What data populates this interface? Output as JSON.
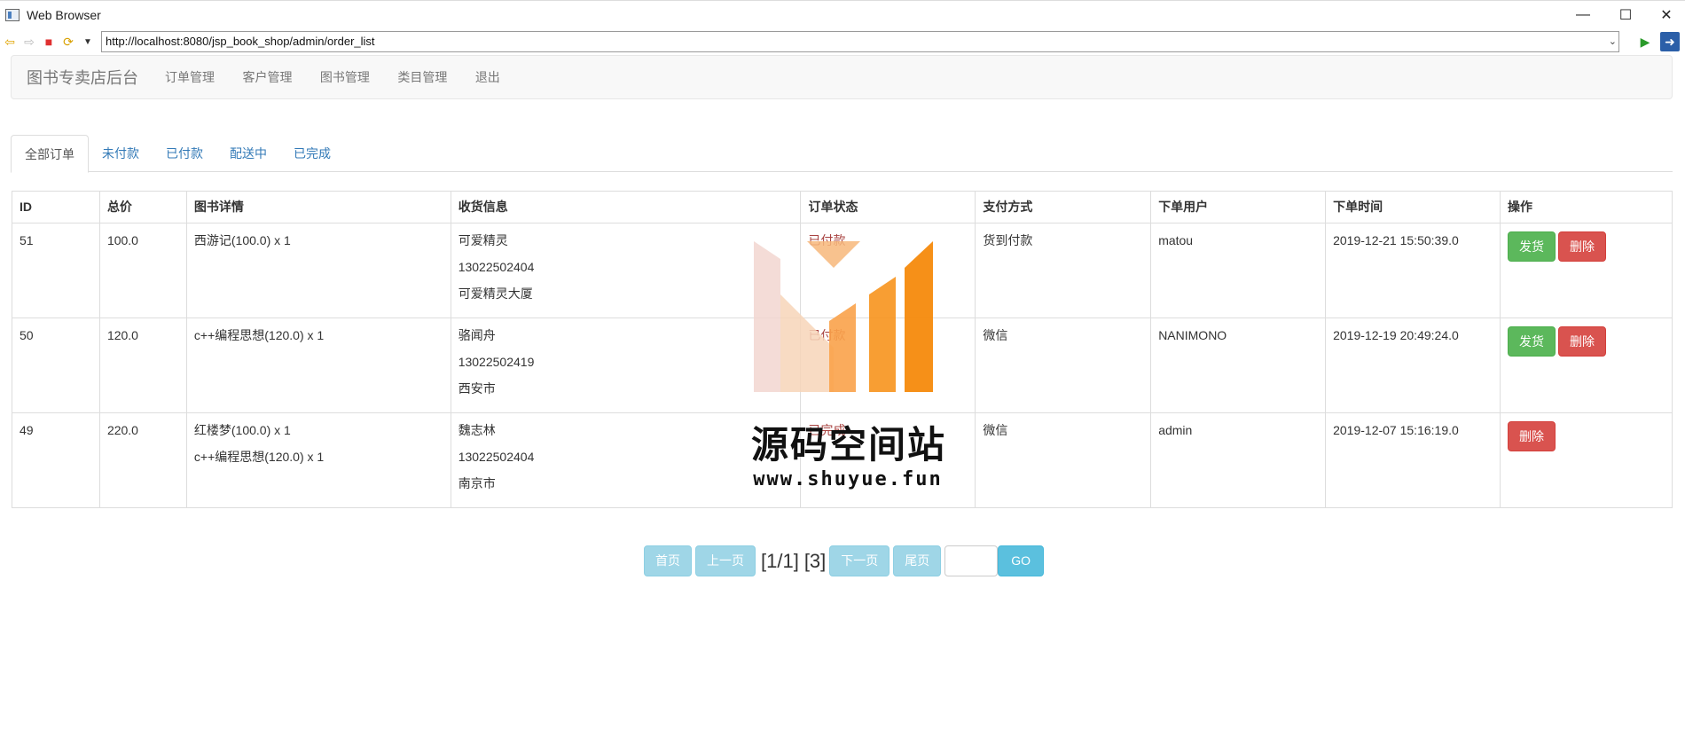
{
  "window": {
    "title": "Web Browser"
  },
  "browser": {
    "url": "http://localhost:8080/jsp_book_shop/admin/order_list"
  },
  "admin": {
    "brand": "图书专卖店后台",
    "menu": [
      "订单管理",
      "客户管理",
      "图书管理",
      "类目管理",
      "退出"
    ]
  },
  "tabs": [
    "全部订单",
    "未付款",
    "已付款",
    "配送中",
    "已完成"
  ],
  "table": {
    "headers": [
      "ID",
      "总价",
      "图书详情",
      "收货信息",
      "订单状态",
      "支付方式",
      "下单用户",
      "下单时间",
      "操作"
    ],
    "rows": [
      {
        "id": "51",
        "total": "100.0",
        "books": [
          "西游记(100.0) x 1"
        ],
        "recipient": "可爱精灵",
        "phone": "13022502404",
        "address": "可爱精灵大厦",
        "status": "已付款",
        "payment": "货到付款",
        "user": "matou",
        "time": "2019-12-21 15:50:39.0",
        "ship_label": "发货",
        "delete_label": "删除"
      },
      {
        "id": "50",
        "total": "120.0",
        "books": [
          "c++编程思想(120.0) x 1"
        ],
        "recipient": "骆闻舟",
        "phone": "13022502419",
        "address": "西安市",
        "status": "已付款",
        "payment": "微信",
        "user": "NANIMONO",
        "time": "2019-12-19 20:49:24.0",
        "ship_label": "发货",
        "delete_label": "删除"
      },
      {
        "id": "49",
        "total": "220.0",
        "books": [
          "红楼梦(100.0) x 1",
          "c++编程思想(120.0) x 1"
        ],
        "recipient": "魏志林",
        "phone": "13022502404",
        "address": "南京市",
        "status": "已完成",
        "payment": "微信",
        "user": "admin",
        "time": "2019-12-07 15:16:19.0",
        "delete_label": "删除"
      }
    ]
  },
  "pagination": {
    "first": "首页",
    "prev": "上一页",
    "page_info": "[1/1]",
    "total": "[3]",
    "next": "下一页",
    "last": "尾页",
    "go": "GO"
  },
  "watermark": {
    "title": "源码空间站",
    "url": "www.shuyue.fun"
  },
  "colors": {
    "link": "#337ab7",
    "success": "#5cb85c",
    "danger": "#d9534f",
    "info": "#5bc0de",
    "brand_orange": "#f7941d"
  }
}
